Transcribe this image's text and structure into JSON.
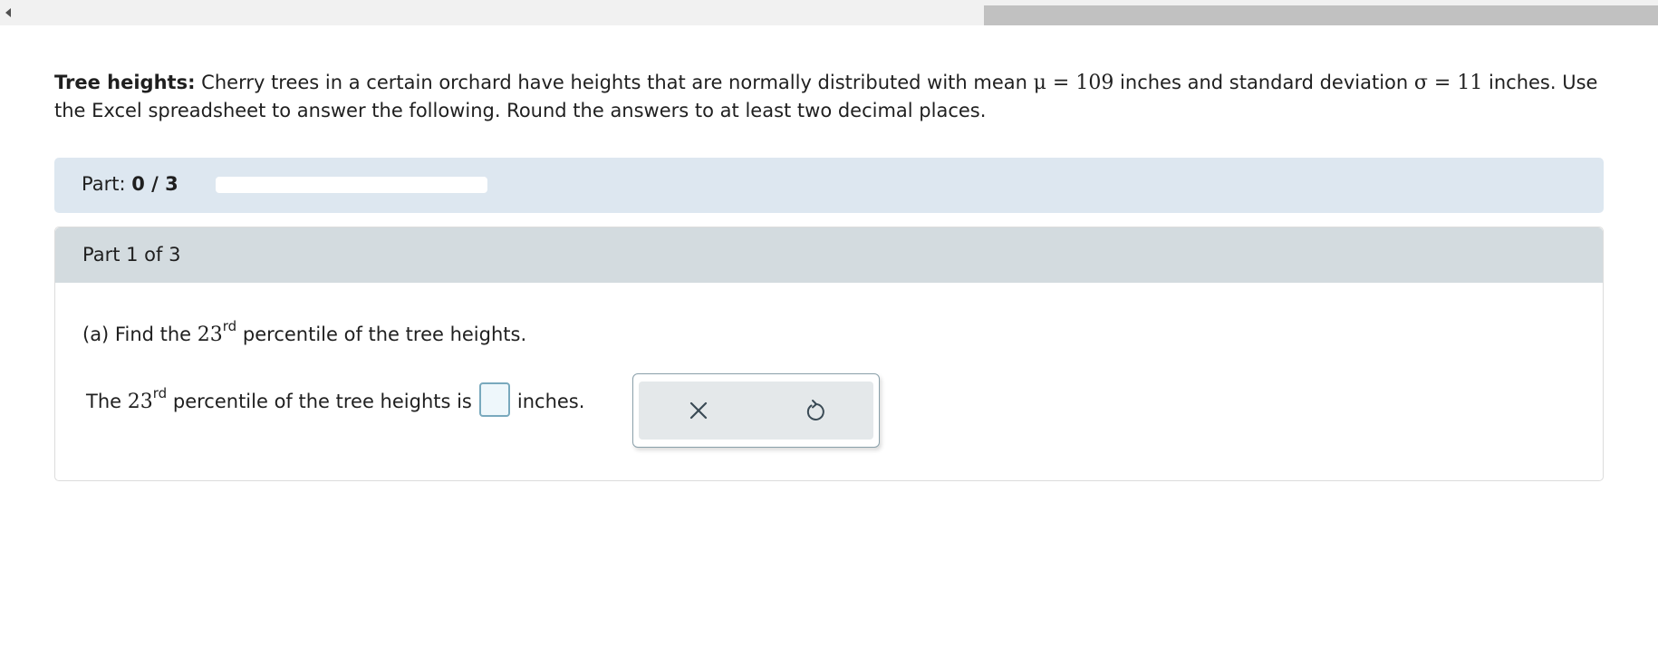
{
  "problem": {
    "title": "Tree heights:",
    "text_1": "Cherry trees in a certain orchard have heights that are normally distributed with mean",
    "mean_symbol": "μ = 109",
    "text_2": "inches and standard deviation",
    "sd_symbol": "σ = 11",
    "text_3": "inches. Use the Excel spreadsheet to answer the following. Round the answers to at least two decimal places."
  },
  "progress": {
    "label": "Part:",
    "value": "0 / 3",
    "fraction": 0
  },
  "part": {
    "header": "Part 1 of 3",
    "question_prefix": "(a) Find the",
    "question_number": "23",
    "question_ordinal": "rd",
    "question_suffix": "percentile of the tree heights.",
    "answer_prefix": "The",
    "answer_number": "23",
    "answer_ordinal": "rd",
    "answer_middle": "percentile of the tree heights is",
    "answer_value": "",
    "answer_suffix": "inches."
  },
  "tools": {
    "clear_icon": "close-x-icon",
    "undo_icon": "undo-icon"
  }
}
